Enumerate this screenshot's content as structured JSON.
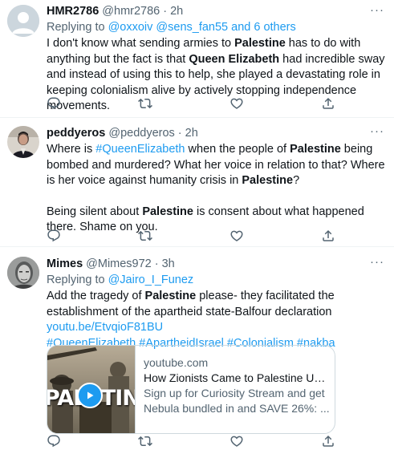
{
  "tweets": [
    {
      "name": "HMR2786",
      "handle": "@hmr2786",
      "dot": "·",
      "time": "2h",
      "replying_prefix": "Replying to ",
      "replying_to": "@oxxoiv @sens_fan55 and 6 others",
      "text": [
        "I don't know what sending armies to ",
        "Palestine",
        " has to do with anything but the fact is that ",
        "Queen Elizabeth",
        " had incredible sway and instead of using this to help, she played a devastating role in keeping colonialism alive by actively stopping independence movements."
      ]
    },
    {
      "name": "peddyeros",
      "handle": "@peddyeros",
      "dot": "·",
      "time": "2h",
      "text1": [
        "Where is ",
        "#QueenElizabeth",
        " when the people of ",
        "Palestine",
        " being bombed and murdered? What her voice in relation to that? Where is her voice against humanity crisis in ",
        "Palestine",
        "?"
      ],
      "text2": [
        "Being silent about ",
        "Palestine",
        " is consent about what happened there. Shame on you."
      ]
    },
    {
      "name": "Mimes",
      "handle": "@Mimes972",
      "dot": "·",
      "time": "3h",
      "replying_prefix": "Replying to ",
      "replying_to": "@Jairo_I_Funez",
      "text": [
        "Add the tragedy of ",
        "Palestine",
        " please- they facilitated the establishment of the apartheid state-Balfour declaration",
        "youtu.be/EtvqioF81BU"
      ],
      "hashtags": "#QueenElizabeth #ApartheidIsrael #Colonialism #nakba",
      "card": {
        "thumb_text": "PALSTIN",
        "domain": "youtube.com",
        "title": "How Zionists Came to Palestine Under British Prot...",
        "description": "Sign up for Curiosity Stream and get Nebula bundled in and SAVE 26%: ..."
      }
    }
  ],
  "icons": {
    "more": "more-horizontal-icon",
    "reply": "reply-icon",
    "retweet": "retweet-icon",
    "like": "heart-icon",
    "share": "share-icon",
    "play": "play-icon"
  },
  "colors": {
    "link": "#1d9bf0",
    "secondary": "#536471",
    "text": "#0f1419",
    "border": "#eff3f4",
    "youtube_play": "#1d9bf0"
  }
}
